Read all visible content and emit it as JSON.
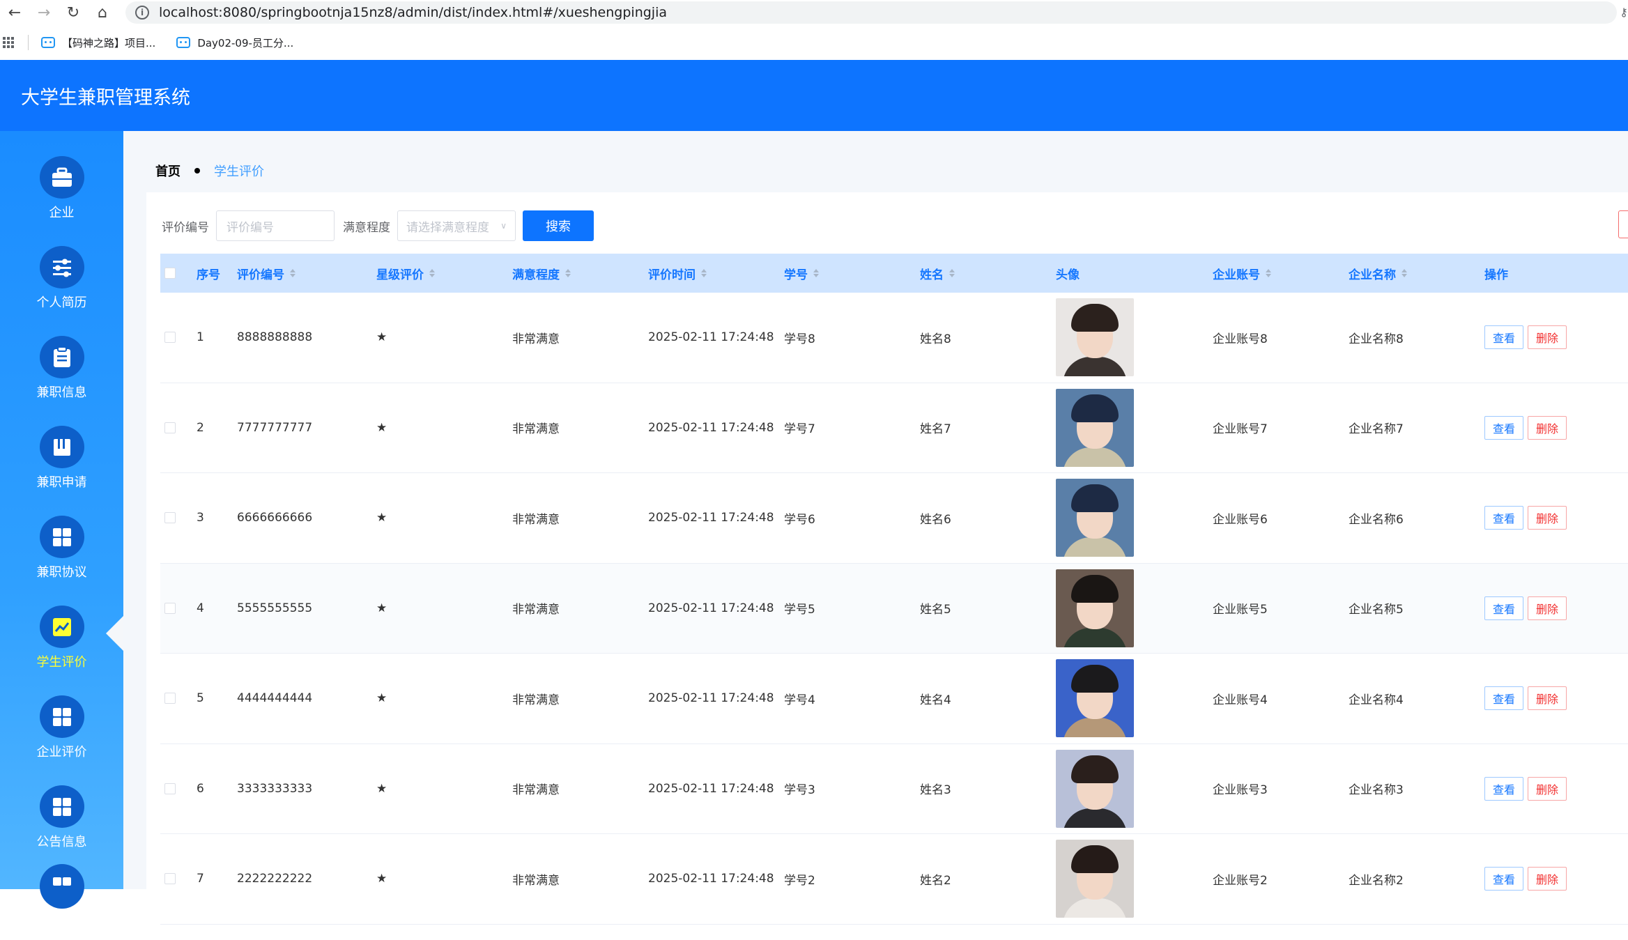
{
  "browser": {
    "url": "localhost:8080/springbootnja15nz8/admin/dist/index.html#/xueshengpingjia",
    "bookmarks": [
      "【码神之路】项目...",
      "Day02-09-员工分..."
    ]
  },
  "app": {
    "title": "大学生兼职管理系统"
  },
  "sidebar": {
    "items": [
      {
        "label": "企业",
        "icon": "briefcase-icon"
      },
      {
        "label": "个人简历",
        "icon": "sliders-icon"
      },
      {
        "label": "兼职信息",
        "icon": "clipboard-icon"
      },
      {
        "label": "兼职申请",
        "icon": "book-icon"
      },
      {
        "label": "兼职协议",
        "icon": "grid-icon"
      },
      {
        "label": "学生评价",
        "icon": "chart-icon"
      },
      {
        "label": "企业评价",
        "icon": "grid-icon"
      },
      {
        "label": "公告信息",
        "icon": "grid-icon"
      }
    ],
    "active_index": 5
  },
  "breadcrumb": {
    "home": "首页",
    "current": "学生评价"
  },
  "search": {
    "code_label": "评价编号",
    "code_placeholder": "评价编号",
    "satisfaction_label": "满意程度",
    "satisfaction_placeholder": "请选择满意程度",
    "button": "搜索"
  },
  "table": {
    "headers": [
      "序号",
      "评价编号",
      "星级评价",
      "满意程度",
      "评价时间",
      "学号",
      "姓名",
      "头像",
      "企业账号",
      "企业名称",
      "操作"
    ],
    "view_label": "查看",
    "delete_label": "删除",
    "rows": [
      {
        "idx": "1",
        "code": "8888888888",
        "star": "★",
        "satisfaction": "非常满意",
        "time": "2025-02-11 17:24:48",
        "sno": "学号8",
        "name": "姓名8",
        "account": "企业账号8",
        "company": "企业名称8"
      },
      {
        "idx": "2",
        "code": "7777777777",
        "star": "★",
        "satisfaction": "非常满意",
        "time": "2025-02-11 17:24:48",
        "sno": "学号7",
        "name": "姓名7",
        "account": "企业账号7",
        "company": "企业名称7"
      },
      {
        "idx": "3",
        "code": "6666666666",
        "star": "★",
        "satisfaction": "非常满意",
        "time": "2025-02-11 17:24:48",
        "sno": "学号6",
        "name": "姓名6",
        "account": "企业账号6",
        "company": "企业名称6"
      },
      {
        "idx": "4",
        "code": "5555555555",
        "star": "★",
        "satisfaction": "非常满意",
        "time": "2025-02-11 17:24:48",
        "sno": "学号5",
        "name": "姓名5",
        "account": "企业账号5",
        "company": "企业名称5"
      },
      {
        "idx": "5",
        "code": "4444444444",
        "star": "★",
        "satisfaction": "非常满意",
        "time": "2025-02-11 17:24:48",
        "sno": "学号4",
        "name": "姓名4",
        "account": "企业账号4",
        "company": "企业名称4"
      },
      {
        "idx": "6",
        "code": "3333333333",
        "star": "★",
        "satisfaction": "非常满意",
        "time": "2025-02-11 17:24:48",
        "sno": "学号3",
        "name": "姓名3",
        "account": "企业账号3",
        "company": "企业名称3"
      },
      {
        "idx": "7",
        "code": "2222222222",
        "star": "★",
        "satisfaction": "非常满意",
        "time": "2025-02-11 17:24:48",
        "sno": "学号2",
        "name": "姓名2",
        "account": "企业账号2",
        "company": "企业名称2"
      }
    ]
  },
  "colors": {
    "primary": "#0d74ff",
    "header_bg": "#cfe4ff",
    "active_menu": "#ffff33",
    "danger": "#f23030"
  }
}
